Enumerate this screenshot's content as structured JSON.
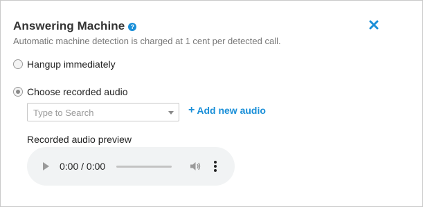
{
  "dialog": {
    "title": "Answering Machine",
    "help_icon": "question-circle-icon",
    "help_glyph": "?",
    "close_icon": "close-x-icon",
    "subtitle": "Automatic machine detection is charged at 1 cent per detected call.",
    "accent_color": "#1a8fd8"
  },
  "options": {
    "hangup_label": "Hangup immediately",
    "hangup_selected": false,
    "recorded_label": "Choose recorded audio",
    "recorded_selected": true
  },
  "audio_select": {
    "placeholder": "Type to Search",
    "selected_value": ""
  },
  "add_audio": {
    "plus": "+",
    "label": "Add new audio"
  },
  "preview": {
    "label": "Recorded audio preview",
    "time": "0:00 / 0:00",
    "progress": 0
  }
}
